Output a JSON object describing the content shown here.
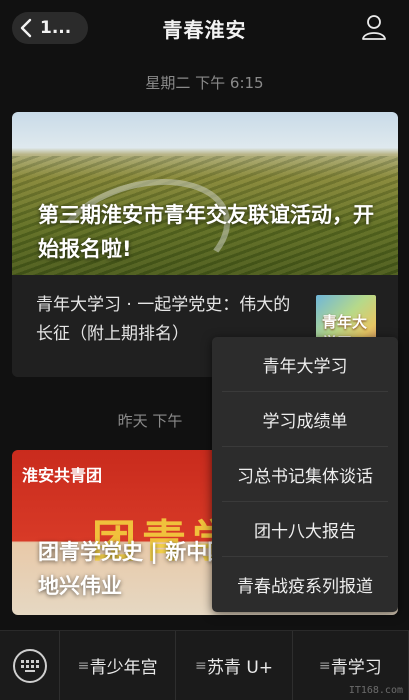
{
  "header": {
    "back_label": "1...",
    "title": "青春淮安"
  },
  "timestamps": {
    "first": "星期二 下午 6:15",
    "second": "昨天 下午"
  },
  "article1": {
    "hero_title": "第三期淮安市青年交友联谊活动，开始报名啦!",
    "sub_title": "青年大学习 · 一起学党史：伟大的长征（附上期排名）",
    "thumb_text": "青年大学习"
  },
  "article2": {
    "logo_text": "淮安共青团",
    "big_text": "团青学",
    "hero_title": "团青学党史 | 新中国 天换地兴伟业"
  },
  "popup_menu": {
    "items": [
      "青年大学习",
      "学习成绩单",
      "习总书记集体谈话",
      "团十八大报告",
      "青春战疫系列报道"
    ]
  },
  "bottom_bar": {
    "tabs": [
      "青少年宫",
      "苏青 U+",
      "青学习"
    ],
    "watermark": "IT168.com"
  }
}
